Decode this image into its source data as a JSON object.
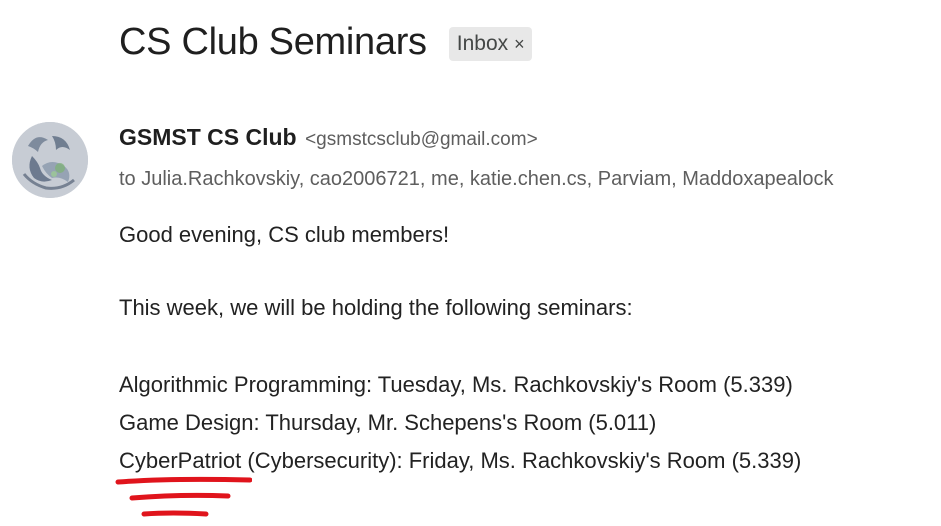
{
  "email": {
    "subject": "CS Club Seminars",
    "label_chip": {
      "text": "Inbox",
      "remove_glyph": "×"
    },
    "sender": {
      "name": "GSMST CS Club",
      "email": "<gsmstcsclub@gmail.com>",
      "avatar_icon": "club-logo-avatar"
    },
    "recipients": "to Julia.Rachkovskiy, cao2006721, me, katie.chen.cs, Parviam, Maddoxapealock",
    "body": {
      "greeting": "Good evening, CS club members!",
      "intro": "This week, we will be holding the following seminars:",
      "seminars": [
        "Algorithmic Programming: Tuesday, Ms. Rachkovskiy's Room (5.339)",
        "Game Design: Thursday, Mr. Schepens's Room (5.011)",
        "CyberPatriot (Cybersecurity): Friday, Ms. Rachkovskiy's Room (5.339)"
      ]
    }
  },
  "annotation": {
    "type": "red-hand-drawn-underline",
    "color": "#e0141c"
  }
}
